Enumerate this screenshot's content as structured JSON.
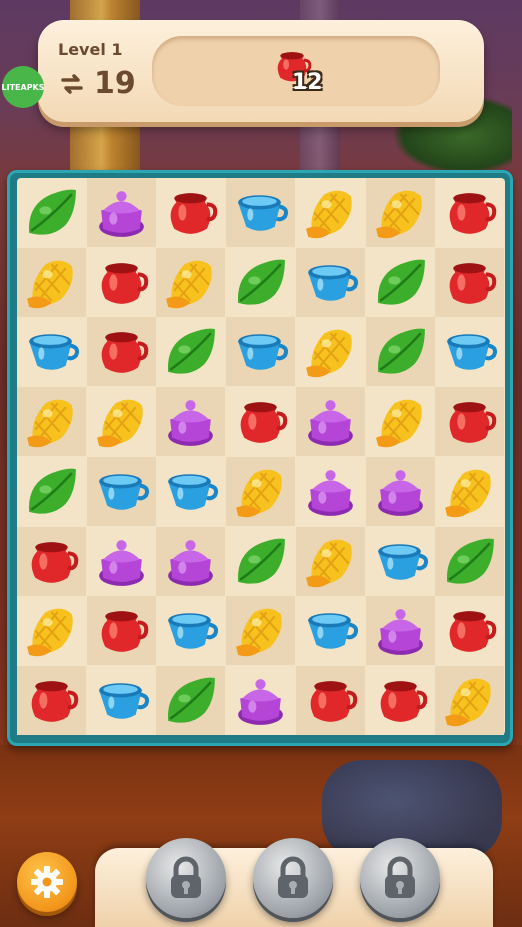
{
  "header": {
    "level_label": "Level 1",
    "moves": "19",
    "goal_item": "red-pot",
    "goal_count": "12"
  },
  "watermark": "LITEAPKS",
  "board": {
    "rows": [
      [
        "leaf",
        "purple-pot",
        "red-pot",
        "cup",
        "corn",
        "corn",
        "red-pot"
      ],
      [
        "corn",
        "red-pot",
        "corn",
        "leaf",
        "cup",
        "leaf",
        "red-pot"
      ],
      [
        "cup",
        "red-pot",
        "leaf",
        "cup",
        "corn",
        "leaf",
        "cup"
      ],
      [
        "corn",
        "corn",
        "purple-pot",
        "red-pot",
        "purple-pot",
        "corn",
        "red-pot"
      ],
      [
        "leaf",
        "cup",
        "cup",
        "corn",
        "purple-pot",
        "purple-pot",
        "corn"
      ],
      [
        "red-pot",
        "purple-pot",
        "purple-pot",
        "leaf",
        "corn",
        "cup",
        "leaf"
      ],
      [
        "corn",
        "red-pot",
        "cup",
        "corn",
        "cup",
        "purple-pot",
        "red-pot"
      ],
      [
        "red-pot",
        "cup",
        "leaf",
        "purple-pot",
        "red-pot",
        "red-pot",
        "corn"
      ]
    ]
  },
  "bottom": {
    "boosters": [
      "locked",
      "locked",
      "locked"
    ],
    "settings_icon": "gear-icon"
  },
  "colors": {
    "red-pot": "#e0282a",
    "purple-pot": "#b445d6",
    "cup": "#2aa0e0",
    "corn": "#f7c21e",
    "leaf": "#3cae2c"
  }
}
